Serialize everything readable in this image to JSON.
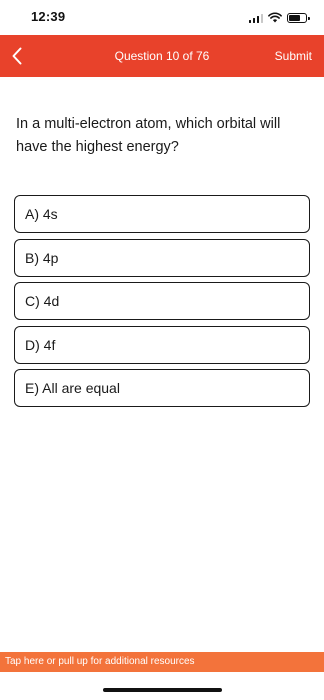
{
  "status_bar": {
    "time": "12:39"
  },
  "nav": {
    "title": "Question 10 of 76",
    "submit_label": "Submit",
    "back_icon": "chevron-left-icon"
  },
  "question": {
    "text": "In a multi-electron atom, which orbital will have the highest energy?"
  },
  "options": [
    {
      "label": "A) 4s"
    },
    {
      "label": "B) 4p"
    },
    {
      "label": "C) 4d"
    },
    {
      "label": "D) 4f"
    },
    {
      "label": "E) All are equal"
    }
  ],
  "footer": {
    "resources_text": "Tap here or pull up for additional resources"
  },
  "colors": {
    "accent": "#e8422b",
    "resources_bar": "#f3733b",
    "option_border": "#1a1a1a"
  }
}
